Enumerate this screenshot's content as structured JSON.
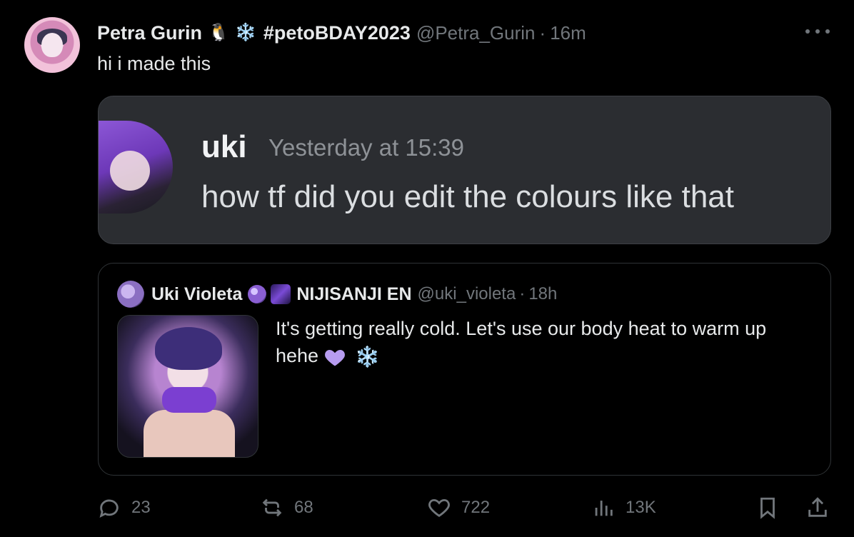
{
  "tweet": {
    "author_name": "Petra Gurin",
    "emoji_1": "🐧",
    "emoji_2": "❄️",
    "hashtag": "#petoBDAY2023",
    "handle": "@Petra_Gurin",
    "separator": "·",
    "time": "16m",
    "text": "hi i made this"
  },
  "discord": {
    "username": "uki",
    "timestamp": "Yesterday at 15:39",
    "message": "how tf did you edit the colours like that"
  },
  "quote": {
    "author_name": "Uki Violeta",
    "org": "NIJISANJI EN",
    "handle": "@uki_violeta",
    "separator": "·",
    "time": "18h",
    "text": "It's getting really cold. Let's use our body heat to warm up hehe",
    "trailing_emoji": "❄️"
  },
  "actions": {
    "replies": "23",
    "reposts": "68",
    "likes": "722",
    "views": "13K"
  },
  "colors": {
    "background": "#000000",
    "text_primary": "#e7e9ea",
    "text_secondary": "#71767b",
    "discord_bg": "#2b2d31",
    "heart_emoji": "#b79cf0"
  },
  "icons": [
    "more-icon",
    "reply-icon",
    "repost-icon",
    "like-icon",
    "views-icon",
    "bookmark-icon",
    "share-icon"
  ]
}
